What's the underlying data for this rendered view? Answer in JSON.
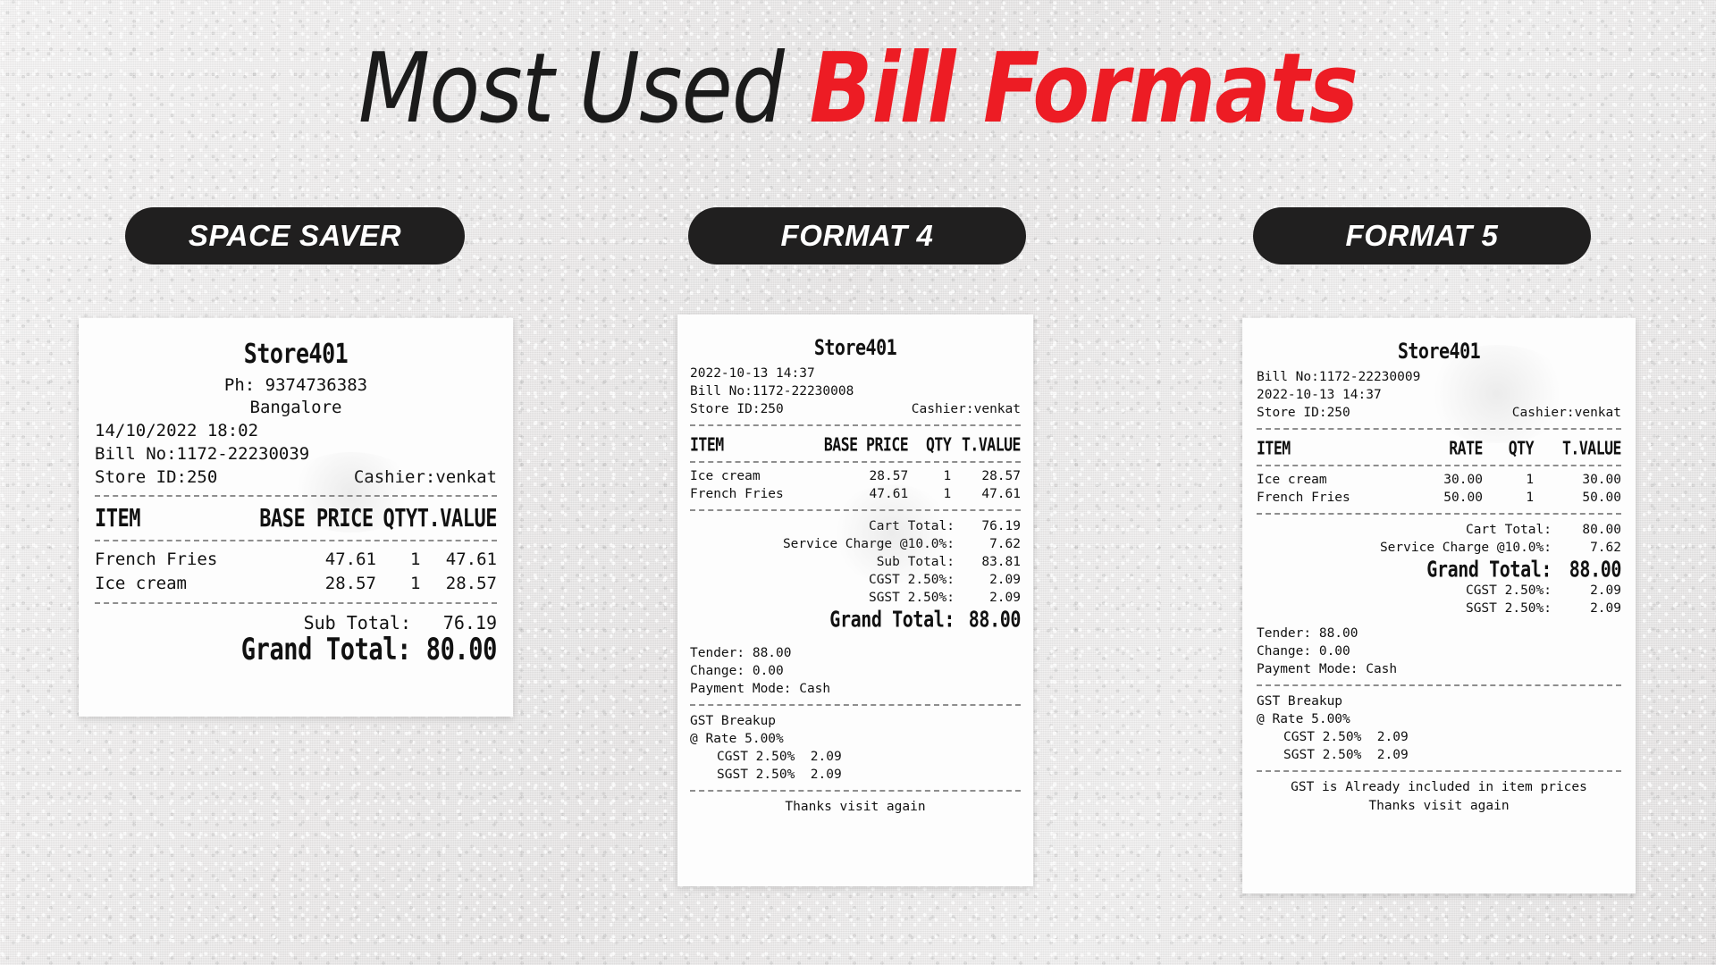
{
  "heading": {
    "text_dark": "Most Used ",
    "text_red": "Bill Formats",
    "accent_color": "#ed1c24"
  },
  "badges": [
    {
      "label": "SPACE SAVER"
    },
    {
      "label": "FORMAT 4"
    },
    {
      "label": "FORMAT 5"
    }
  ],
  "receipts": [
    {
      "store_name": "Store401",
      "phone": "Ph: 9374736383",
      "city": "Bangalore",
      "datetime": "14/10/2022 18:02",
      "bill_no": "Bill No:1172-22230039",
      "store_id": "Store ID:250",
      "cashier": "Cashier:venkat",
      "columns": {
        "item": "ITEM",
        "price": "BASE PRICE",
        "qty": "QTY",
        "value": "T.VALUE"
      },
      "items": [
        {
          "name": "French Fries",
          "price": "47.61",
          "qty": "1",
          "value": "47.61"
        },
        {
          "name": "Ice cream",
          "price": "28.57",
          "qty": "1",
          "value": "28.57"
        }
      ],
      "totals": [
        {
          "label": "Sub Total:",
          "value": "76.19",
          "big": false
        },
        {
          "label": "Grand Total:",
          "value": "80.00",
          "big": true
        }
      ]
    },
    {
      "store_name": "Store401",
      "datetime": "2022-10-13 14:37",
      "bill_no": "Bill No:1172-22230008",
      "store_id": "Store ID:250",
      "cashier": "Cashier:venkat",
      "columns": {
        "item": "ITEM",
        "price": "BASE PRICE",
        "qty": "QTY",
        "value": "T.VALUE"
      },
      "items": [
        {
          "name": "Ice cream",
          "price": "28.57",
          "qty": "1",
          "value": "28.57"
        },
        {
          "name": "French Fries",
          "price": "47.61",
          "qty": "1",
          "value": "47.61"
        }
      ],
      "totals": [
        {
          "label": "Cart Total:",
          "value": "76.19",
          "big": false
        },
        {
          "label": "Service Charge @10.0%:",
          "value": "7.62",
          "big": false
        },
        {
          "label": "Sub Total:",
          "value": "83.81",
          "big": false
        },
        {
          "label": "CGST 2.50%:",
          "value": "2.09",
          "big": false
        },
        {
          "label": "SGST 2.50%:",
          "value": "2.09",
          "big": false
        },
        {
          "label": "Grand Total:",
          "value": "88.00",
          "big": true
        }
      ],
      "payment": {
        "tender": "Tender: 88.00",
        "change": "Change: 0.00",
        "mode": "Payment Mode: Cash"
      },
      "gst": {
        "title": "GST Breakup",
        "rate": "@ Rate 5.00%",
        "lines": [
          "CGST 2.50%  2.09",
          "SGST 2.50%  2.09"
        ]
      },
      "footer": [
        "Thanks visit again"
      ]
    },
    {
      "store_name": "Store401",
      "bill_no": "Bill No:1172-22230009",
      "datetime": "2022-10-13 14:37",
      "store_id": "Store ID:250",
      "cashier": "Cashier:venkat",
      "columns": {
        "item": "ITEM",
        "price": "RATE",
        "qty": "QTY",
        "value": "T.VALUE"
      },
      "items": [
        {
          "name": "Ice cream",
          "price": "30.00",
          "qty": "1",
          "value": "30.00"
        },
        {
          "name": "French Fries",
          "price": "50.00",
          "qty": "1",
          "value": "50.00"
        }
      ],
      "totals": [
        {
          "label": "Cart Total:",
          "value": "80.00",
          "big": false
        },
        {
          "label": "Service Charge @10.0%:",
          "value": "7.62",
          "big": false
        },
        {
          "label": "Grand Total:",
          "value": "88.00",
          "big": true
        },
        {
          "label": "CGST 2.50%:",
          "value": "2.09",
          "big": false
        },
        {
          "label": "SGST 2.50%:",
          "value": "2.09",
          "big": false
        }
      ],
      "payment": {
        "tender": "Tender: 88.00",
        "change": "Change: 0.00",
        "mode": "Payment Mode: Cash"
      },
      "gst": {
        "title": "GST Breakup",
        "rate": "@ Rate 5.00%",
        "lines": [
          "CGST 2.50%  2.09",
          "SGST 2.50%  2.09"
        ]
      },
      "footer": [
        "GST is Already included in item prices",
        "Thanks visit again"
      ]
    }
  ]
}
